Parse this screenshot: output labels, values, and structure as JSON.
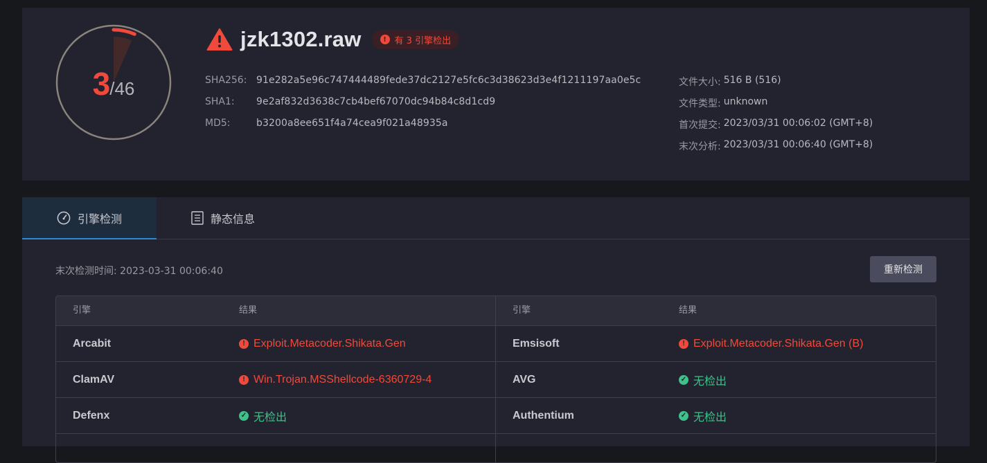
{
  "summary": {
    "detected": "3",
    "total": "/46",
    "detection_ratio": 0.0652,
    "file_name": "jzk1302.raw",
    "badge": "有 3 引擎检出",
    "hashes": [
      {
        "key": "SHA256:",
        "value": "91e282a5e96c747444489fede37dc2127e5fc6c3d38623d3e4f1211197aa0e5c"
      },
      {
        "key": "SHA1:",
        "value": "9e2af832d3638c7cb4bef67070dc94b84c8d1cd9"
      },
      {
        "key": "MD5:",
        "value": "b3200a8ee651f4a74cea9f021a48935a"
      }
    ],
    "meta": [
      {
        "key": "文件大小:",
        "value": "516 B (516)"
      },
      {
        "key": "文件类型:",
        "value": "unknown"
      },
      {
        "key": "首次提交:",
        "value": "2023/03/31 00:06:02 (GMT+8)"
      },
      {
        "key": "末次分析:",
        "value": "2023/03/31 00:06:40 (GMT+8)"
      }
    ],
    "colors": {
      "danger": "#ef4a3c",
      "ring": "#8a847d",
      "ok": "#3ec18a"
    }
  },
  "tabs": [
    {
      "label": "引擎检测",
      "icon": "gauge-icon",
      "active": true
    },
    {
      "label": "静态信息",
      "icon": "document-list-icon",
      "active": false
    }
  ],
  "scan": {
    "last_time": "末次检测时间: 2023-03-31 00:06:40",
    "rescan_label": "重新检测"
  },
  "table": {
    "headers": {
      "engine": "引擎",
      "result": "结果"
    },
    "rows": [
      {
        "left": {
          "engine": "Arcabit",
          "result": "Exploit.Metacoder.Shikata.Gen",
          "status": "detected"
        },
        "right": {
          "engine": "Emsisoft",
          "result": "Exploit.Metacoder.Shikata.Gen (B)",
          "status": "detected"
        }
      },
      {
        "left": {
          "engine": "ClamAV",
          "result": "Win.Trojan.MSShellcode-6360729-4",
          "status": "detected"
        },
        "right": {
          "engine": "AVG",
          "result": "无检出",
          "status": "clean"
        }
      },
      {
        "left": {
          "engine": "Defenx",
          "result": "无检出",
          "status": "clean"
        },
        "right": {
          "engine": "Authentium",
          "result": "无检出",
          "status": "clean"
        }
      }
    ]
  }
}
